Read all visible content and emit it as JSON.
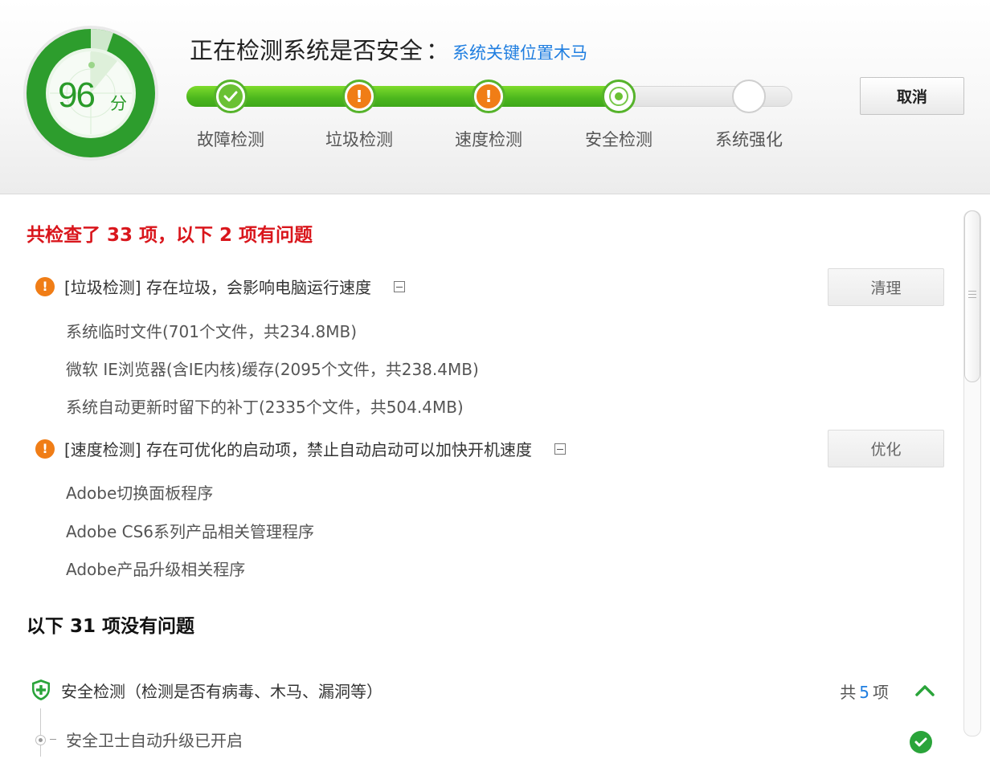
{
  "score": {
    "value": "96",
    "unit": "分"
  },
  "scan": {
    "title": "正在检测系统是否安全",
    "colon": "：",
    "target": "系统关键位置木马"
  },
  "steps": [
    {
      "label": "故障检测",
      "status": "done"
    },
    {
      "label": "垃圾检测",
      "status": "warning"
    },
    {
      "label": "速度检测",
      "status": "warning"
    },
    {
      "label": "安全检测",
      "status": "current"
    },
    {
      "label": "系统强化",
      "status": "pending"
    }
  ],
  "progress_percent": 71,
  "cancel_label": "取消",
  "summary": "共检查了 33 项，以下 2 项有问题",
  "issues": [
    {
      "title": "[垃圾检测] 存在垃圾，会影响电脑运行速度",
      "button": "清理",
      "items": [
        "系统临时文件(701个文件，共234.8MB)",
        "微软 IE浏览器(含IE内核)缓存(2095个文件，共238.4MB)",
        "系统自动更新时留下的补丁(2335个文件，共504.4MB)"
      ]
    },
    {
      "title": "[速度检测] 存在可优化的启动项，禁止自动启动可以加快开机速度",
      "button": "优化",
      "items": [
        "Adobe切换面板程序",
        "Adobe CS6系列产品相关管理程序",
        "Adobe产品升级相关程序"
      ]
    }
  ],
  "ok_summary": "以下 31 项没有问题",
  "categories": [
    {
      "label": "安全检测（检测是否有病毒、木马、漏洞等）",
      "count_prefix": "共",
      "count": "5",
      "count_suffix": "项",
      "items": [
        "安全卫士自动升级已开启"
      ]
    }
  ],
  "colors": {
    "accent_green": "#4bb61d",
    "warning_orange": "#f07d16",
    "alert_red": "#d9161c",
    "link_blue": "#1f7ee0"
  },
  "icons": {
    "step_done": "check-icon",
    "step_warning": "exclamation-icon",
    "issue": "warning-icon",
    "category": "shield-plus-icon",
    "expand": "chevron-up-icon",
    "ok": "check-circle-icon"
  }
}
